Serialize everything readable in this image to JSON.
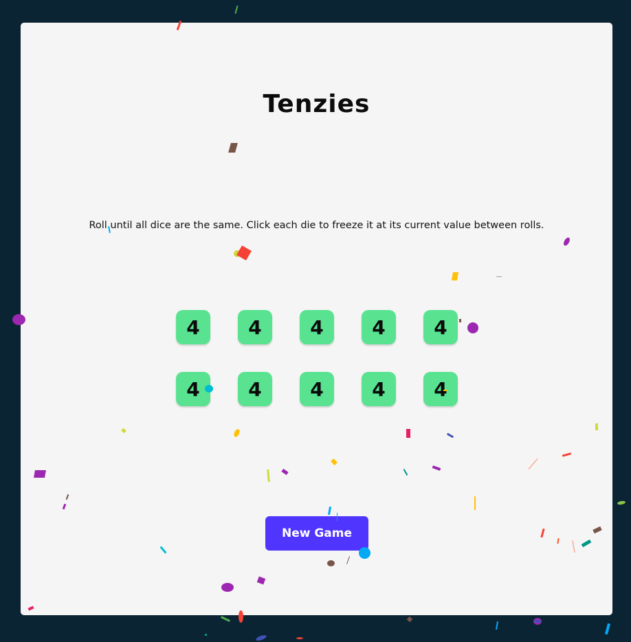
{
  "game": {
    "title": "Tenzies",
    "instructions": "Roll until all dice are the same. Click each die to freeze it at its current value between rolls.",
    "dice": [
      4,
      4,
      4,
      4,
      4,
      4,
      4,
      4,
      4,
      4
    ],
    "new_game_label": "New Game"
  },
  "colors": {
    "background": "#0b2434",
    "card": "#f5f5f5",
    "die": "#59e391",
    "button": "#5035ff",
    "button_text": "#ffffff"
  }
}
